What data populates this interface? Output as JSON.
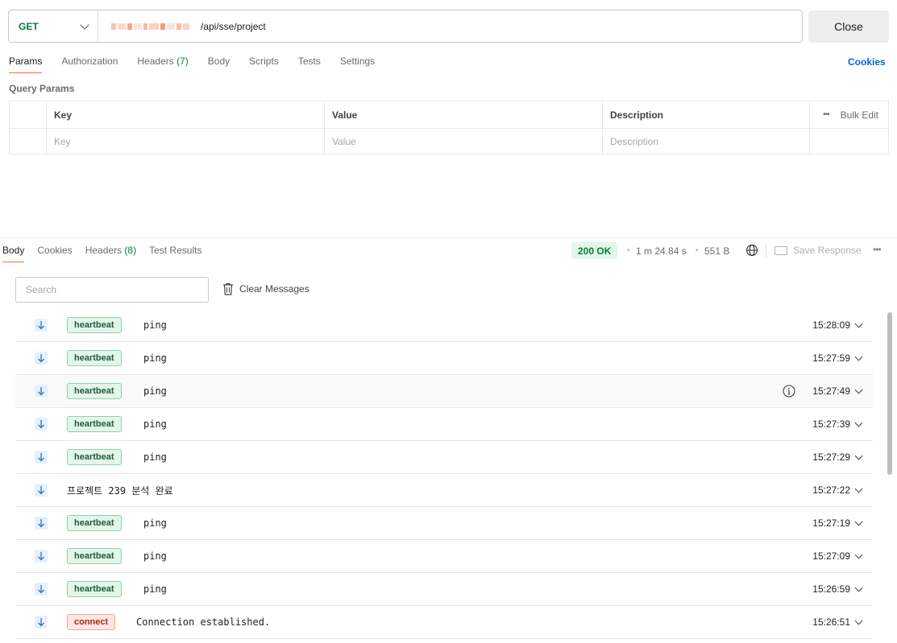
{
  "request": {
    "method": "GET",
    "url_path": "/api/sse/project",
    "close_label": "Close"
  },
  "request_tabs": [
    {
      "label": "Params"
    },
    {
      "label": "Authorization"
    },
    {
      "label": "Headers",
      "count": "(7)"
    },
    {
      "label": "Body"
    },
    {
      "label": "Scripts"
    },
    {
      "label": "Tests"
    },
    {
      "label": "Settings"
    }
  ],
  "cookies_label": "Cookies",
  "query_params": {
    "title": "Query Params",
    "headers": {
      "key": "Key",
      "value": "Value",
      "description": "Description",
      "bulk_edit": "Bulk Edit"
    },
    "placeholders": {
      "key": "Key",
      "value": "Value",
      "description": "Description"
    }
  },
  "response_tabs": [
    {
      "label": "Body"
    },
    {
      "label": "Cookies"
    },
    {
      "label": "Headers",
      "count": "(8)"
    },
    {
      "label": "Test Results"
    }
  ],
  "response_meta": {
    "status": "200 OK",
    "time": "1 m 24.84 s",
    "size": "551 B",
    "save_response": "Save Response"
  },
  "search": {
    "placeholder": "Search"
  },
  "clear_messages": "Clear Messages",
  "messages": [
    {
      "tag": "heartbeat",
      "text": "ping",
      "time": "15:28:09"
    },
    {
      "tag": "heartbeat",
      "text": "ping",
      "time": "15:27:59"
    },
    {
      "tag": "heartbeat",
      "text": "ping",
      "time": "15:27:49",
      "info": true
    },
    {
      "tag": "heartbeat",
      "text": "ping",
      "time": "15:27:39"
    },
    {
      "tag": "heartbeat",
      "text": "ping",
      "time": "15:27:29"
    },
    {
      "tag": "",
      "text": "프로젝트 239 분석 완료",
      "time": "15:27:22"
    },
    {
      "tag": "heartbeat",
      "text": "ping",
      "time": "15:27:19"
    },
    {
      "tag": "heartbeat",
      "text": "ping",
      "time": "15:27:09"
    },
    {
      "tag": "heartbeat",
      "text": "ping",
      "time": "15:26:59"
    },
    {
      "tag": "connect",
      "text": "Connection established.",
      "time": "15:26:51"
    }
  ],
  "colors": {
    "accent": "#ff6c37",
    "success": "#0b7a3e",
    "link": "#0265d2"
  }
}
